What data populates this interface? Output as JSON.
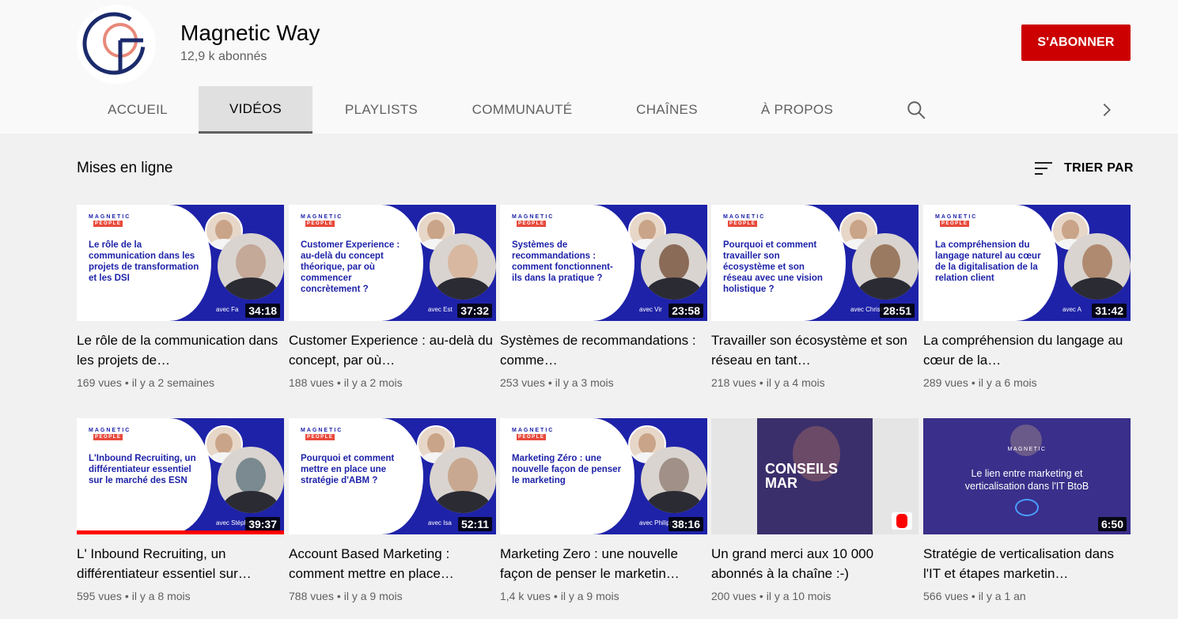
{
  "channel": {
    "name": "Magnetic Way",
    "subscribers": "12,9 k abonnés",
    "subscribe_label": "S'ABONNER",
    "colors": {
      "ring": "#1b2a6b",
      "accent": "#e8897a"
    }
  },
  "tabs": [
    {
      "label": "ACCUEIL",
      "active": false
    },
    {
      "label": "VIDÉOS",
      "active": true
    },
    {
      "label": "PLAYLISTS",
      "active": false
    },
    {
      "label": "COMMUNAUTÉ",
      "active": false
    },
    {
      "label": "CHAÎNES",
      "active": false
    },
    {
      "label": "À PROPOS",
      "active": false
    }
  ],
  "icons": {
    "search": "search-icon",
    "next": "chevron-right-icon",
    "sort": "sort-icon"
  },
  "section": {
    "title": "Mises en ligne",
    "sort_label": "TRIER PAR"
  },
  "thumb_brand": {
    "line1": "MAGNETIC",
    "line2": "PEOPLE"
  },
  "videos": [
    {
      "thumb_text": "Le rôle de la communication dans les projets de transformation et les DSI",
      "avec": "avec Fa",
      "duration": "34:18",
      "title": "Le rôle de la communication dans les projets de…",
      "views": "169 vues",
      "age": "il y a 2 semaines"
    },
    {
      "thumb_text": "Customer Experience : au-delà du concept théorique, par où commencer concrètement ?",
      "avec": "avec Est",
      "duration": "37:32",
      "title": "Customer Experience : au-delà du concept, par où…",
      "views": "188 vues",
      "age": "il y a 2 mois"
    },
    {
      "thumb_text": "Systèmes de recommandations : comment fonctionnent-ils dans la pratique ?",
      "avec": "avec Vir",
      "duration": "23:58",
      "title": "Systèmes de recommandations : comme…",
      "views": "253 vues",
      "age": "il y a 3 mois"
    },
    {
      "thumb_text": "Pourquoi et comment travailler son écosystème et son réseau avec une vision holistique ?",
      "avec": "avec Christop",
      "duration": "28:51",
      "title": "Travailler son écosystème et son réseau en tant…",
      "views": "218 vues",
      "age": "il y a 4 mois"
    },
    {
      "thumb_text": "La compréhension du langage naturel au cœur de la digitalisation de la relation client",
      "avec": "avec A",
      "duration": "31:42",
      "title": "La compréhension du langage au cœur de la…",
      "views": "289 vues",
      "age": "il y a 6 mois"
    },
    {
      "thumb_text": "L'Inbound Recruiting, un différentiateur essentiel sur le marché des ESN",
      "avec": "avec Stéphan",
      "duration": "39:37",
      "title": "L' Inbound Recruiting, un différentiateur essentiel sur…",
      "views": "595 vues",
      "age": "il y a 8 mois",
      "watched": 1
    },
    {
      "thumb_text": "Pourquoi et comment mettre en place une stratégie d'ABM ?",
      "avec": "avec Isa",
      "duration": "52:11",
      "title": "Account Based Marketing : comment mettre en place…",
      "views": "788 vues",
      "age": "il y a 9 mois"
    },
    {
      "thumb_text": "Marketing Zéro : une nouvelle façon de penser le marketing",
      "avec": "avec Philippe",
      "duration": "38:16",
      "title": "Marketing Zero : une nouvelle façon de penser le marketin…",
      "views": "1,4 k vues",
      "age": "il y a 9 mois"
    },
    {
      "thumb_text": "CONSEILS MAR",
      "duration": "",
      "title": "Un grand merci aux 10 000 abonnés à la chaîne :-)",
      "views": "200 vues",
      "age": "il y a 10 mois",
      "short": true
    },
    {
      "thumb_text": "Le lien entre marketing et verticalisation dans l'IT BtoB",
      "brand_small": "MAGNETIC",
      "duration": "6:50",
      "title": "Stratégie de verticalisation dans l'IT et étapes marketin…",
      "views": "566 vues",
      "age": "il y a 1 an",
      "dark": true
    }
  ]
}
